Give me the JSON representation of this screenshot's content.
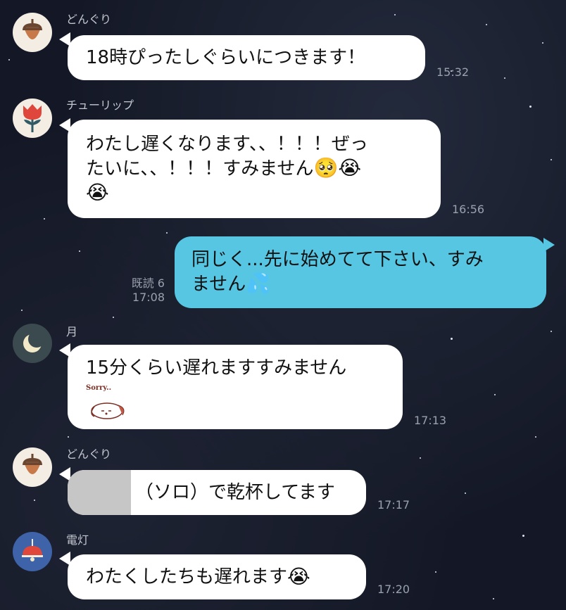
{
  "chat": {
    "messages": [
      {
        "sender": "どんぐり",
        "avatar_icon": "acorn-icon",
        "text": "18時ぴったしぐらいにつきます！",
        "time": "15:32"
      },
      {
        "sender": "チューリップ",
        "avatar_icon": "tulip-icon",
        "line1": "わたし遅くなります、、！！！ぜっ",
        "line2": "たいに、、！！！すみません",
        "emoji_pleading": "🥺",
        "emoji_cry1": "😭",
        "emoji_cry2": "😭",
        "time": "16:56"
      },
      {
        "sender": "me",
        "line1": "同じく...先に始めてて下さい、すみ",
        "line2": "ません",
        "emoji_sweat": "💦",
        "read_label": "既読 6",
        "time": "17:08"
      },
      {
        "sender": "月",
        "avatar_icon": "moon-icon",
        "text": "15分くらい遅れますすみません",
        "sticker_text": "Sorry..",
        "time": "17:13"
      },
      {
        "sender": "どんぐり",
        "avatar_icon": "acorn-icon",
        "text": "（ソロ）で乾杯してます",
        "time": "17:17"
      },
      {
        "sender": "電灯",
        "avatar_icon": "lamp-icon",
        "text": "わたくしたちも遅れます",
        "emoji_cry": "😭",
        "time": "17:20"
      }
    ]
  },
  "colors": {
    "background": "#141826",
    "incoming_bubble": "#ffffff",
    "outgoing_bubble": "#56c6e3",
    "meta_text": "#9aa1ae"
  }
}
